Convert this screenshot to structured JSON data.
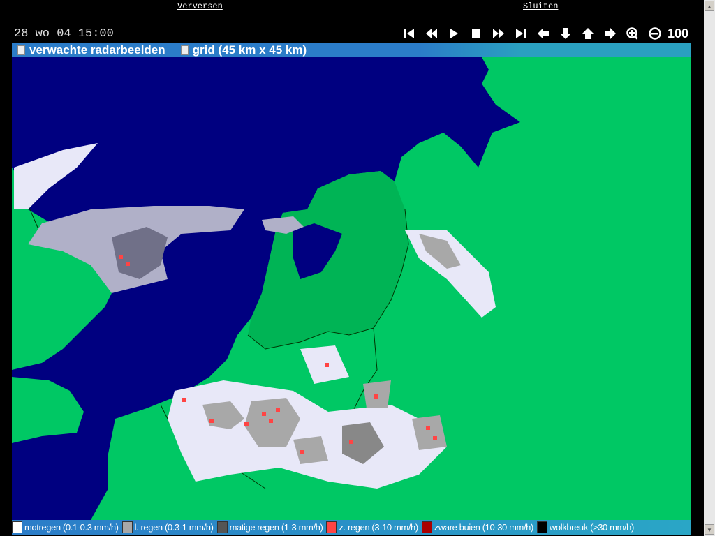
{
  "top_links": {
    "refresh": "Verversen",
    "close": "Sluiten"
  },
  "timestamp": "28 wo 04 15:00",
  "controls": [
    {
      "name": "first-frame-icon"
    },
    {
      "name": "rewind-icon"
    },
    {
      "name": "play-icon"
    },
    {
      "name": "stop-icon"
    },
    {
      "name": "fast-forward-icon"
    },
    {
      "name": "last-frame-icon"
    },
    {
      "name": "pan-left-icon"
    },
    {
      "name": "pan-down-icon"
    },
    {
      "name": "pan-up-icon"
    },
    {
      "name": "pan-right-icon"
    },
    {
      "name": "zoom-in-icon"
    },
    {
      "name": "zoom-out-icon"
    }
  ],
  "zoom_level": "100",
  "options": {
    "forecast": "verwachte radarbeelden",
    "grid": "grid (45 km x 45 km)"
  },
  "legend": [
    {
      "label": "motregen (0.1-0.3 mm/h)",
      "color": "#ffffff"
    },
    {
      "label": "l. regen (0.3-1 mm/h)",
      "color": "#a8a8a8"
    },
    {
      "label": "matige regen (1-3 mm/h)",
      "color": "#555555"
    },
    {
      "label": "z. regen (3-10 mm/h)",
      "color": "#ff4444"
    },
    {
      "label": "zware buien (10-30 mm/h)",
      "color": "#aa0000"
    },
    {
      "label": "wolkbreuk (>30 mm/h)",
      "color": "#000000"
    }
  ],
  "colors": {
    "sea": "#000080",
    "land": "#00c864",
    "land_nl": "#00b455"
  }
}
